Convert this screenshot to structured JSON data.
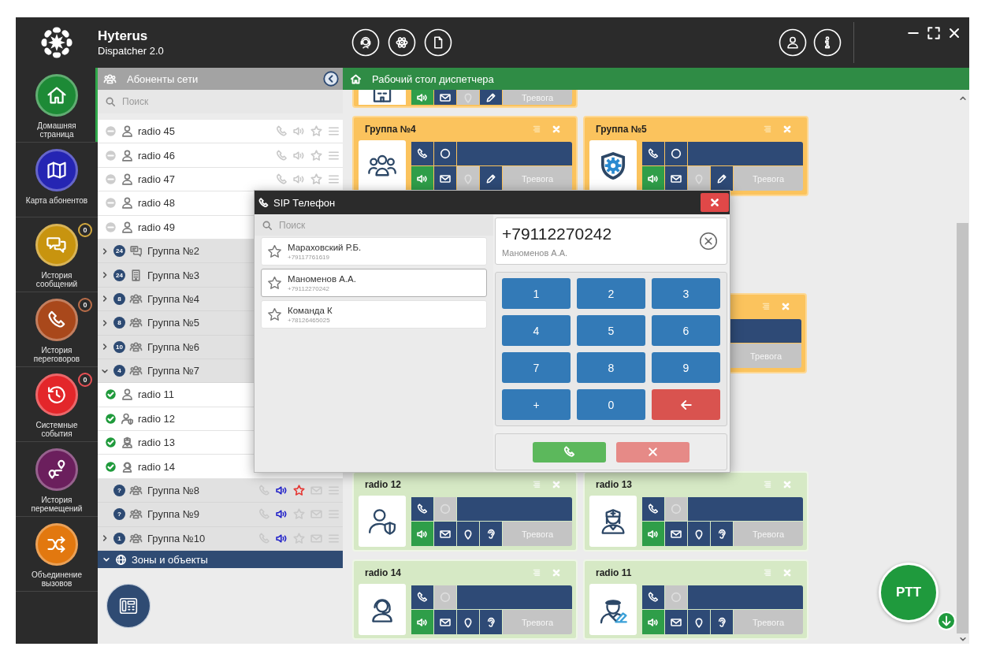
{
  "app": {
    "brand": "Hyterus",
    "subtitle": "Dispatcher 2.0"
  },
  "nav": [
    {
      "kind": "home",
      "label": "Домашняя страница",
      "color": "#1d8a36",
      "selected": true
    },
    {
      "kind": "map",
      "label": "Карта абонентов",
      "color": "#2525b3",
      "selected": false
    },
    {
      "kind": "messages",
      "label": "История сообщений",
      "color": "#c8940f",
      "selected": false,
      "badge": "0"
    },
    {
      "kind": "calls",
      "label": "История переговоров",
      "color": "#a9481b",
      "selected": false,
      "badge": "0"
    },
    {
      "kind": "events",
      "label": "Системные события",
      "color": "#e3262a",
      "selected": false,
      "badge": "0"
    },
    {
      "kind": "moves",
      "label": "История перемещений",
      "color": "#6b1f5d",
      "selected": false
    },
    {
      "kind": "merge",
      "label": "Объединение вызовов",
      "color": "#e2780f",
      "selected": false
    }
  ],
  "subscribers": {
    "title": "Абоненты сети",
    "search": {
      "placeholder": "Поиск"
    },
    "items": [
      {
        "kind": "radio",
        "label": "radio 45",
        "online": false,
        "icon": {
          "kind": "person"
        },
        "actions": [
          {
            "kind": "phone",
            "on": false
          },
          {
            "kind": "speaker",
            "on": false
          },
          {
            "kind": "star",
            "on": false
          },
          {
            "kind": "menu",
            "on": false
          }
        ]
      },
      {
        "kind": "radio",
        "label": "radio 46",
        "online": false,
        "icon": {
          "kind": "person"
        },
        "actions": [
          {
            "kind": "phone",
            "on": false
          },
          {
            "kind": "speaker",
            "on": false
          },
          {
            "kind": "star",
            "on": false
          },
          {
            "kind": "menu",
            "on": false
          }
        ]
      },
      {
        "kind": "radio",
        "label": "radio 47",
        "online": false,
        "icon": {
          "kind": "person"
        },
        "actions": [
          {
            "kind": "phone",
            "on": false
          },
          {
            "kind": "speaker",
            "on": false
          },
          {
            "kind": "star",
            "on": false
          },
          {
            "kind": "menu",
            "on": false
          }
        ]
      },
      {
        "kind": "radio",
        "label": "radio 48",
        "online": false,
        "icon": {
          "kind": "person"
        }
      },
      {
        "kind": "radio",
        "label": "radio 49",
        "online": false,
        "icon": {
          "kind": "person"
        }
      },
      {
        "kind": "group",
        "label": "Группа №2",
        "count": "24",
        "expandable": true,
        "expanded": false,
        "icon": {
          "kind": "chat"
        }
      },
      {
        "kind": "group",
        "label": "Группа №3",
        "count": "24",
        "expandable": true,
        "expanded": false,
        "icon": {
          "kind": "building"
        }
      },
      {
        "kind": "group",
        "label": "Группа №4",
        "count": "8",
        "expandable": true,
        "expanded": false,
        "icon": {
          "kind": "team"
        }
      },
      {
        "kind": "group",
        "label": "Группа №5",
        "count": "8",
        "expandable": true,
        "expanded": false,
        "icon": {
          "kind": "team"
        }
      },
      {
        "kind": "group",
        "label": "Группа №6",
        "count": "10",
        "expandable": true,
        "expanded": false,
        "icon": {
          "kind": "team"
        }
      },
      {
        "kind": "group",
        "label": "Группа №7",
        "count": "4",
        "expandable": true,
        "expanded": true,
        "icon": {
          "kind": "team"
        },
        "children": [
          {
            "kind": "radio",
            "label": "radio 11",
            "online": true,
            "icon": {
              "kind": "person"
            }
          },
          {
            "kind": "radio",
            "label": "radio 12",
            "online": true,
            "icon": {
              "kind": "person_shield"
            }
          },
          {
            "kind": "radio",
            "label": "radio 13",
            "online": true,
            "icon": {
              "kind": "nurse"
            }
          },
          {
            "kind": "radio",
            "label": "radio 14",
            "online": true,
            "icon": {
              "kind": "headset_person"
            }
          }
        ]
      },
      {
        "kind": "group",
        "label": "Группа №8",
        "count": "?",
        "expandable": false,
        "icon": {
          "kind": "team"
        },
        "actions": [
          {
            "kind": "phone",
            "on": false
          },
          {
            "kind": "speaker",
            "on": true
          },
          {
            "kind": "star",
            "on": true
          },
          {
            "kind": "mail",
            "on": false
          },
          {
            "kind": "menu",
            "on": false
          }
        ]
      },
      {
        "kind": "group",
        "label": "Группа №9",
        "count": "?",
        "expandable": false,
        "icon": {
          "kind": "team"
        },
        "actions": [
          {
            "kind": "phone",
            "on": false
          },
          {
            "kind": "speaker",
            "on": true
          },
          {
            "kind": "star",
            "on": false
          },
          {
            "kind": "mail",
            "on": false
          },
          {
            "kind": "menu",
            "on": false
          }
        ]
      },
      {
        "kind": "group",
        "label": "Группа №10",
        "count": "1",
        "expandable": true,
        "expanded": false,
        "icon": {
          "kind": "team"
        },
        "actions": [
          {
            "kind": "phone",
            "on": false
          },
          {
            "kind": "speaker",
            "on": true
          },
          {
            "kind": "star",
            "on": false
          },
          {
            "kind": "mail",
            "on": false
          },
          {
            "kind": "menu",
            "on": false
          }
        ]
      }
    ],
    "zones": {
      "title": "Зоны и объекты",
      "expanded": true
    }
  },
  "workspace": {
    "title": "Рабочий стол диспетчера",
    "rows": [
      {
        "cards": [
          {
            "kind": "group",
            "top_hidden": true,
            "left_hidden": false,
            "image": {
              "kind": "building"
            },
            "bottom_actions": [
              {
                "kind": "speaker",
                "on": true,
                "disabled": false
              },
              {
                "kind": "mail",
                "on": false,
                "disabled": false
              },
              {
                "kind": "pin",
                "on": false,
                "disabled": true
              },
              {
                "kind": "pencil",
                "on": false,
                "disabled": false
              }
            ],
            "alarm": {
              "label": "Тревога",
              "disabled": true
            }
          }
        ]
      },
      {
        "cards": [
          {
            "kind": "group",
            "top_hidden": false,
            "left_hidden": false,
            "title": "Группа №4",
            "image": {
              "kind": "team"
            },
            "top_actions": [
              {
                "kind": "phone",
                "on": false,
                "disabled": false
              },
              {
                "kind": "ring",
                "on": false,
                "disabled": false
              }
            ],
            "bottom_actions": [
              {
                "kind": "speaker",
                "on": true,
                "disabled": false
              },
              {
                "kind": "mail",
                "on": false,
                "disabled": false
              },
              {
                "kind": "pin",
                "on": false,
                "disabled": true
              },
              {
                "kind": "pencil",
                "on": false,
                "disabled": false
              }
            ],
            "alarm": {
              "label": "Тревога",
              "disabled": true
            }
          },
          {
            "kind": "group",
            "top_hidden": false,
            "left_hidden": false,
            "title": "Группа №5",
            "image": {
              "kind": "shield"
            },
            "top_actions": [
              {
                "kind": "phone",
                "on": false,
                "disabled": false
              },
              {
                "kind": "ring",
                "on": false,
                "disabled": false
              }
            ],
            "bottom_actions": [
              {
                "kind": "speaker",
                "on": true,
                "disabled": false
              },
              {
                "kind": "mail",
                "on": false,
                "disabled": false
              },
              {
                "kind": "pin",
                "on": false,
                "disabled": true
              },
              {
                "kind": "pencil",
                "on": false,
                "disabled": false
              }
            ],
            "alarm": {
              "label": "Тревога",
              "disabled": true
            }
          }
        ]
      },
      {
        "cards": [
          {
            "kind": "group",
            "top_hidden": false,
            "left_hidden": true,
            "alarm": {
              "label": "Тревога",
              "disabled": true
            }
          }
        ]
      },
      {
        "cards": [
          {
            "kind": "radio",
            "top_hidden": false,
            "left_hidden": false,
            "title": "radio 12",
            "image": {
              "kind": "person_shield"
            },
            "top_actions": [
              {
                "kind": "phone",
                "on": false,
                "disabled": false
              },
              {
                "kind": "ring",
                "on": false,
                "disabled": true
              }
            ],
            "bottom_actions": [
              {
                "kind": "speaker",
                "on": true,
                "disabled": false
              },
              {
                "kind": "mail",
                "on": false,
                "disabled": false
              },
              {
                "kind": "pin",
                "on": false,
                "disabled": false
              },
              {
                "kind": "ear",
                "on": false,
                "disabled": false
              }
            ],
            "alarm": {
              "label": "Тревога",
              "disabled": true
            }
          },
          {
            "kind": "radio",
            "top_hidden": false,
            "left_hidden": false,
            "title": "radio 13",
            "image": {
              "kind": "nurse"
            },
            "top_actions": [
              {
                "kind": "phone",
                "on": false,
                "disabled": false
              },
              {
                "kind": "ring",
                "on": false,
                "disabled": true
              }
            ],
            "bottom_actions": [
              {
                "kind": "speaker",
                "on": true,
                "disabled": false
              },
              {
                "kind": "mail",
                "on": false,
                "disabled": false
              },
              {
                "kind": "pin",
                "on": false,
                "disabled": false
              },
              {
                "kind": "ear",
                "on": false,
                "disabled": false
              }
            ],
            "alarm": {
              "label": "Тревога",
              "disabled": true
            }
          }
        ]
      },
      {
        "cards": [
          {
            "kind": "radio",
            "top_hidden": false,
            "left_hidden": false,
            "title": "radio 14",
            "image": {
              "kind": "headset_person"
            },
            "top_actions": [
              {
                "kind": "phone",
                "on": false,
                "disabled": false
              },
              {
                "kind": "ring",
                "on": false,
                "disabled": true
              }
            ],
            "bottom_actions": [
              {
                "kind": "speaker",
                "on": true,
                "disabled": false
              },
              {
                "kind": "mail",
                "on": false,
                "disabled": false
              },
              {
                "kind": "pin",
                "on": false,
                "disabled": false
              },
              {
                "kind": "ear",
                "on": false,
                "disabled": false
              }
            ],
            "alarm": {
              "label": "Тревога",
              "disabled": true
            }
          },
          {
            "kind": "radio",
            "top_hidden": false,
            "left_hidden": false,
            "title": "radio 11",
            "image": {
              "kind": "officer"
            },
            "top_actions": [
              {
                "kind": "phone",
                "on": false,
                "disabled": false
              },
              {
                "kind": "ring",
                "on": false,
                "disabled": true
              }
            ],
            "bottom_actions": [
              {
                "kind": "speaker",
                "on": true,
                "disabled": false
              },
              {
                "kind": "mail",
                "on": false,
                "disabled": false
              },
              {
                "kind": "pin",
                "on": false,
                "disabled": false
              },
              {
                "kind": "ear",
                "on": false,
                "disabled": false
              }
            ],
            "alarm": {
              "label": "Тревога",
              "disabled": true
            }
          }
        ]
      }
    ]
  },
  "ptt": {
    "label": "PTT"
  },
  "sip_phone": {
    "title": "SIP Телефон",
    "search": {
      "placeholder": "Поиск"
    },
    "contacts": [
      {
        "name": "Мараховский Р.Б.",
        "number": "+79117761619",
        "favorite": false,
        "selected": false
      },
      {
        "name": "Маноменов А.А.",
        "number": "+79112270242",
        "favorite": false,
        "selected": true
      },
      {
        "name": "Команда К",
        "number": "+78126465025",
        "favorite": false,
        "selected": false
      }
    ],
    "dial": {
      "number": "+79112270242",
      "name": "Маноменов А.А."
    },
    "keys": [
      {
        "kind": "digit",
        "label": "1"
      },
      {
        "kind": "digit",
        "label": "2"
      },
      {
        "kind": "digit",
        "label": "3"
      },
      {
        "kind": "digit",
        "label": "4"
      },
      {
        "kind": "digit",
        "label": "5"
      },
      {
        "kind": "digit",
        "label": "6"
      },
      {
        "kind": "digit",
        "label": "7"
      },
      {
        "kind": "digit",
        "label": "8"
      },
      {
        "kind": "digit",
        "label": "9"
      },
      {
        "kind": "digit",
        "label": "+"
      },
      {
        "kind": "digit",
        "label": "0"
      },
      {
        "kind": "backspace"
      }
    ],
    "buttons": [
      {
        "kind": "call",
        "disabled": false
      },
      {
        "kind": "hangup",
        "disabled": true
      }
    ]
  }
}
